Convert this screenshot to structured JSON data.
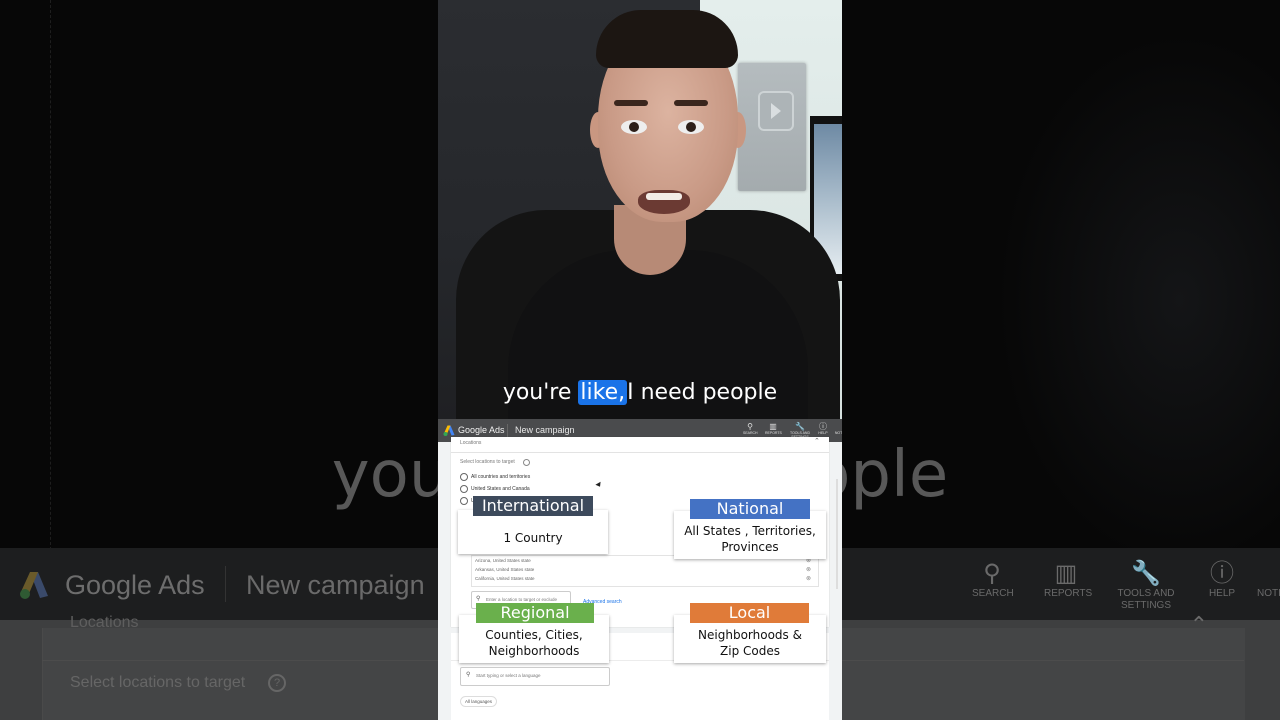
{
  "video": {
    "caption": {
      "before": "you're",
      "highlight": "like,",
      "after": "I need people"
    },
    "background_caption": {
      "left": "you're",
      "right": "people"
    }
  },
  "google_ads": {
    "brand": "Google Ads",
    "page_title": "New campaign",
    "toolbar": [
      {
        "icon": "search-icon",
        "glyph": "⚲",
        "label": "SEARCH"
      },
      {
        "icon": "reports-icon",
        "glyph": "▥",
        "label": "REPORTS"
      },
      {
        "icon": "wrench-icon",
        "glyph": "🔧",
        "label": "TOOLS AND SETTINGS"
      },
      {
        "icon": "help-icon",
        "glyph": "?",
        "label": "HELP"
      },
      {
        "icon": "notifications-icon",
        "glyph": "",
        "label": "NOTI"
      }
    ],
    "locations": {
      "section_title": "Locations",
      "select_label": "Select locations to target",
      "options": [
        {
          "label": "All countries and territories",
          "selected": false
        },
        {
          "label": "United States and Canada",
          "selected": false
        },
        {
          "label": "United States",
          "selected": false
        }
      ],
      "targeted": [
        "Arizona, United States state",
        "Arkansas, United States state",
        "California, United States state"
      ],
      "search_placeholder": "Enter a location to target or exclude",
      "advanced_search": "Advanced search"
    },
    "languages": {
      "search_placeholder": "Start typing or select a language",
      "chip": "All languages"
    }
  },
  "overlays": [
    {
      "tag": "International",
      "description": "1 Country",
      "color": "#3d4a5c"
    },
    {
      "tag": "National",
      "description": "All States , Territories, Provinces",
      "color": "#4472c4"
    },
    {
      "tag": "Regional",
      "description": "Counties, Cities, Neighborhoods",
      "color": "#6ab04c"
    },
    {
      "tag": "Local",
      "description": "Neighborhoods & Zip Codes",
      "color": "#e07b39"
    }
  ]
}
